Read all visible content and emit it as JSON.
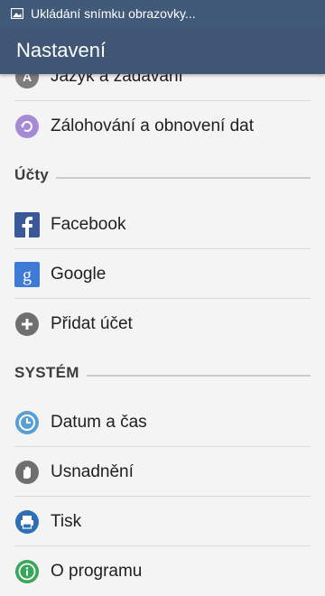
{
  "status_bar": {
    "notification_text": "Ukládání snímku obrazovky..."
  },
  "app_bar": {
    "title": "Nastavení"
  },
  "items_top": [
    {
      "label": "Jazyk a zadávání",
      "icon": "language-icon"
    },
    {
      "label": "Zálohování a obnovení dat",
      "icon": "backup-icon"
    }
  ],
  "sections": {
    "accounts": {
      "header": "Účty",
      "items": [
        {
          "label": "Facebook",
          "icon": "facebook-icon"
        },
        {
          "label": "Google",
          "icon": "google-icon"
        },
        {
          "label": "Přidat účet",
          "icon": "add-account-icon"
        }
      ]
    },
    "system": {
      "header": "SYSTÉM",
      "items": [
        {
          "label": "Datum a čas",
          "icon": "clock-icon"
        },
        {
          "label": "Usnadnění",
          "icon": "accessibility-hand-icon"
        },
        {
          "label": "Tisk",
          "icon": "print-icon"
        },
        {
          "label": "O programu",
          "icon": "info-icon"
        }
      ]
    }
  },
  "colors": {
    "status_bar": "#415a7a",
    "app_bar": "#3f5774",
    "facebook": "#3b5998",
    "google": "#3d7bd6",
    "backup": "#a78ad6",
    "clock": "#5a9fd4",
    "print": "#2f6fb5",
    "info": "#3aa65a"
  }
}
